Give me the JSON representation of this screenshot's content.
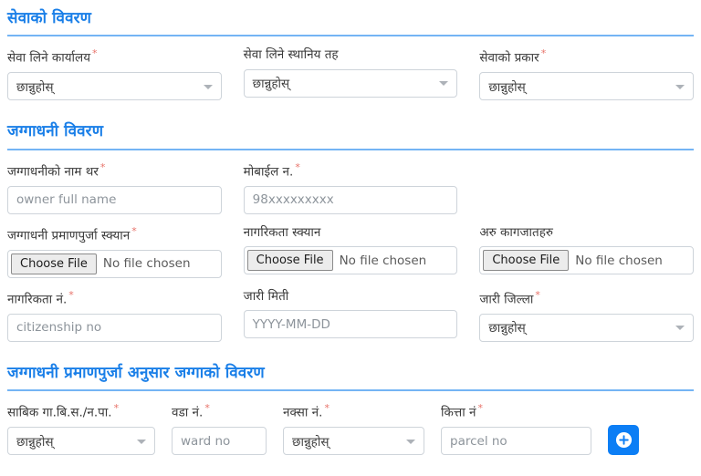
{
  "theme": {
    "heading_color": "#1a7fe8",
    "rule_color": "#74b4f4",
    "required_color": "#e8736a",
    "accent_button_color": "#0c7ef5"
  },
  "sections": [
    {
      "title": "सेवाको विवरण",
      "fields": [
        {
          "label": "सेवा लिने कार्यालय",
          "required": true,
          "type": "select",
          "value": "छान्नुहोस्"
        },
        {
          "label": "सेवा लिने स्थानिय तह",
          "required": false,
          "type": "select",
          "value": "छान्नुहोस्"
        },
        {
          "label": "सेवाको प्रकार",
          "required": true,
          "type": "select",
          "value": "छान्नुहोस्"
        }
      ]
    },
    {
      "title": "जग्गाधनी विवरण",
      "row1": [
        {
          "label": "जग्गाधनीको नाम थर",
          "required": true,
          "type": "text",
          "placeholder": "owner full name"
        },
        {
          "label": "मोबाईल न.",
          "required": true,
          "type": "text",
          "placeholder": "98xxxxxxxxx"
        }
      ],
      "row2": [
        {
          "label": "जग्गाधनी प्रमाणपुर्जा स्क्यान",
          "required": true,
          "type": "file",
          "button": "Choose File",
          "filename": "No file chosen"
        },
        {
          "label": "नागरिकता स्क्यान",
          "required": false,
          "type": "file",
          "button": "Choose File",
          "filename": "No file chosen"
        },
        {
          "label": "अरु कागजातहरु",
          "required": false,
          "type": "file",
          "button": "Choose File",
          "filename": "No file chosen"
        }
      ],
      "row3": [
        {
          "label": "नागरिकता नं.",
          "required": true,
          "type": "text",
          "placeholder": "citizenship no"
        },
        {
          "label": "जारी मिती",
          "required": false,
          "type": "text",
          "placeholder": "YYYY-MM-DD"
        },
        {
          "label": "जारी जिल्ला",
          "required": true,
          "type": "select",
          "value": "छान्नुहोस्"
        }
      ]
    },
    {
      "title": "जग्गाधनी प्रमाणपुर्जा अनुसार जग्गाको विवरण",
      "fields": [
        {
          "label": "साबिक गा.बि.स./न.पा.",
          "required": true,
          "type": "select",
          "value": "छान्नुहोस्"
        },
        {
          "label": "वडा नं.",
          "required": true,
          "type": "text",
          "placeholder": "ward no"
        },
        {
          "label": "नक्सा नं.",
          "required": true,
          "type": "select",
          "value": "छान्नुहोस्"
        },
        {
          "label": "कित्ता नं",
          "required": true,
          "type": "text",
          "placeholder": "parcel no"
        }
      ],
      "add_button_icon": "plus-circle-icon"
    }
  ]
}
